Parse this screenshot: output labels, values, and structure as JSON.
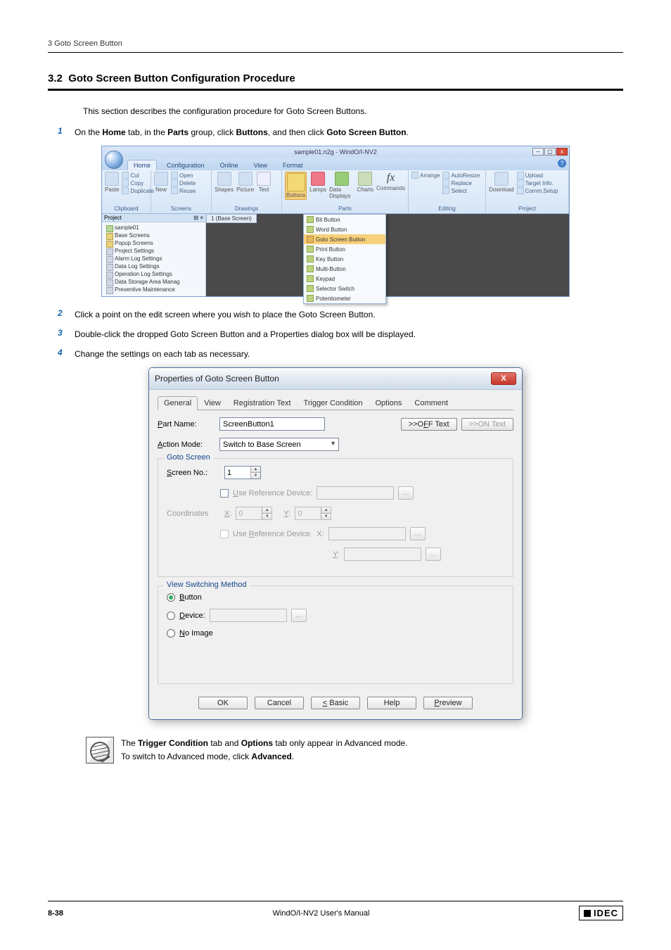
{
  "header": "3 Goto Screen Button",
  "section_number": "3.2",
  "section_title": "Goto Screen Button Configuration Procedure",
  "intro": "This section describes the configuration procedure for Goto Screen Buttons.",
  "steps": {
    "s1_pre": "On the ",
    "s1_b1": "Home",
    "s1_mid1": " tab, in the ",
    "s1_b2": "Parts",
    "s1_mid2": " group, click ",
    "s1_b3": "Buttons",
    "s1_mid3": ", and then click ",
    "s1_b4": "Goto Screen Button",
    "s1_end": ".",
    "s2": "Click a point on the edit screen where you wish to place the Goto Screen Button.",
    "s3": "Double-click the dropped Goto Screen Button and a Properties dialog box will be displayed.",
    "s4": "Change the settings on each tab as necessary."
  },
  "ribbon": {
    "app_title": "sample01.n2g - WindO/I-NV2",
    "tabs": [
      "Home",
      "Configuration",
      "Online",
      "View",
      "Format"
    ],
    "groups": {
      "clipboard": "Clipboard",
      "screens": "Screens",
      "drawings": "Drawings",
      "parts": "Parts",
      "editing": "Editing",
      "project": "Project"
    },
    "clipboard_items": {
      "paste": "Paste",
      "cut": "Cut",
      "copy": "Copy",
      "duplicate": "Duplicate"
    },
    "screens_items": {
      "new": "New",
      "open": "Open",
      "delete": "Delete",
      "reuse": "Reuse"
    },
    "drawings_items": {
      "shapes": "Shapes",
      "picture": "Picture",
      "text": "Text"
    },
    "parts_items": {
      "buttons": "Buttons",
      "lamps": "Lamps",
      "data": "Data Displays",
      "charts": "Charts",
      "commands": "Commands"
    },
    "editing_items": {
      "autoresize": "AutoResize",
      "replace": "Replace",
      "select": "Select",
      "arrange": "Arrange"
    },
    "project_items": {
      "download": "Download",
      "upload": "Upload",
      "target": "Target Info.",
      "comm": "Comm.Setup"
    },
    "buttons_menu": [
      "Bit Button",
      "Word Button",
      "Goto Screen Button",
      "Print Button",
      "Key Button",
      "Multi-Button",
      "Keypad",
      "Selector Switch",
      "Potentiometer"
    ],
    "project_panel": {
      "title": "Project",
      "root": "sample01",
      "items": [
        "Base Screens",
        "Popup Screens",
        "Project Settings",
        "Alarm Log Settings",
        "Data Log Settings",
        "Operation Log Settings",
        "Data Storage Area Manag",
        "Preventive Maintenance"
      ]
    },
    "edit_tab": "1 (Base Screen)"
  },
  "dialog": {
    "title": "Properties of Goto Screen Button",
    "tabs": [
      "General",
      "View",
      "Registration Text",
      "Trigger Condition",
      "Options",
      "Comment"
    ],
    "part_name_label": "Part Name:",
    "part_name_value": "ScreenButton1",
    "off_text": ">>OFF Text",
    "on_text": ">>ON Text",
    "action_mode_label": "Action Mode:",
    "action_mode_value": "Switch to Base Screen",
    "goto_legend": "Goto Screen",
    "screen_no_label": "Screen No.:",
    "screen_no_value": "1",
    "use_ref": "Use Reference Device:",
    "coord_label": "Coordinates",
    "coord_x": "X:",
    "coord_y": "Y:",
    "coord_xv": "0",
    "coord_yv": "0",
    "use_ref_xy": "Use Reference Device   X:",
    "use_ref_y": "Y:",
    "view_legend": "View Switching Method",
    "r_button": "Button",
    "r_device": "Device:",
    "r_noimage": "No Image",
    "btn_ok": "OK",
    "btn_cancel": "Cancel",
    "btn_basic": "< Basic",
    "btn_help": "Help",
    "btn_preview": "Preview"
  },
  "note": {
    "line1_pre": "The ",
    "line1_b1": "Trigger Condition",
    "line1_mid": " tab and ",
    "line1_b2": "Options",
    "line1_end": " tab only appear in Advanced mode.",
    "line2_pre": "To switch to Advanced mode, click ",
    "line2_b": "Advanced",
    "line2_end": "."
  },
  "footer": {
    "page": "8-38",
    "manual": "WindO/I-NV2 User's Manual",
    "brand": "IDEC"
  }
}
